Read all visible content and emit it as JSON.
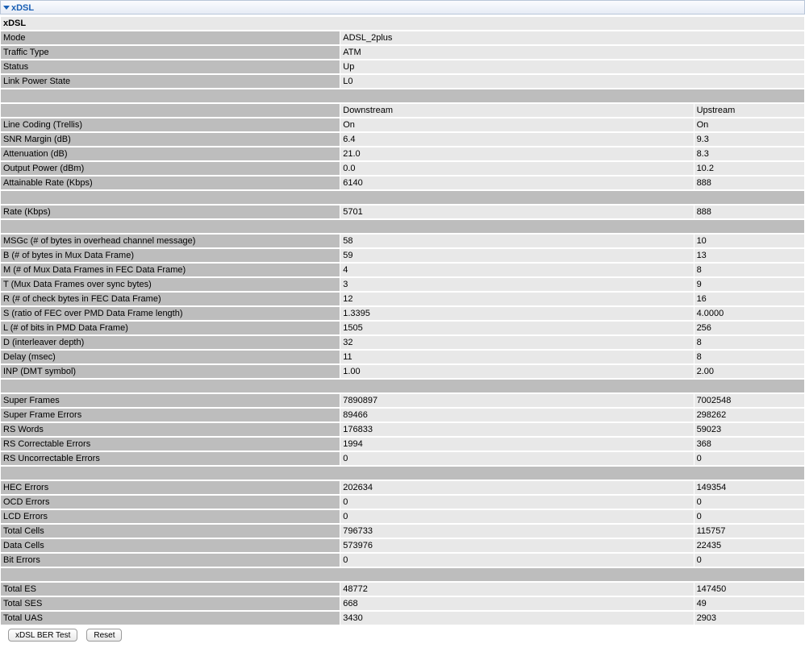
{
  "header": {
    "title": "xDSL"
  },
  "section_title": "xDSL",
  "general": [
    {
      "label": "Mode",
      "value": "ADSL_2plus"
    },
    {
      "label": "Traffic Type",
      "value": "ATM"
    },
    {
      "label": "Status",
      "value": "Up"
    },
    {
      "label": "Link Power State",
      "value": "L0"
    }
  ],
  "columns": {
    "downstream": "Downstream",
    "upstream": "Upstream"
  },
  "groups": [
    [
      {
        "label": "Line Coding (Trellis)",
        "down": "On",
        "up": "On"
      },
      {
        "label": "SNR Margin (dB)",
        "down": "6.4",
        "up": "9.3"
      },
      {
        "label": "Attenuation (dB)",
        "down": "21.0",
        "up": "8.3"
      },
      {
        "label": "Output Power (dBm)",
        "down": "0.0",
        "up": "10.2"
      },
      {
        "label": "Attainable Rate (Kbps)",
        "down": "6140",
        "up": "888"
      }
    ],
    [
      {
        "label": "Rate (Kbps)",
        "down": "5701",
        "up": "888"
      }
    ],
    [
      {
        "label": "MSGc (# of bytes in overhead channel message)",
        "down": "58",
        "up": "10"
      },
      {
        "label": "B (# of bytes in Mux Data Frame)",
        "down": "59",
        "up": "13"
      },
      {
        "label": "M (# of Mux Data Frames in FEC Data Frame)",
        "down": "4",
        "up": "8"
      },
      {
        "label": "T (Mux Data Frames over sync bytes)",
        "down": "3",
        "up": "9"
      },
      {
        "label": "R (# of check bytes in FEC Data Frame)",
        "down": "12",
        "up": "16"
      },
      {
        "label": "S (ratio of FEC over PMD Data Frame length)",
        "down": "1.3395",
        "up": "4.0000"
      },
      {
        "label": "L (# of bits in PMD Data Frame)",
        "down": "1505",
        "up": "256"
      },
      {
        "label": "D (interleaver depth)",
        "down": "32",
        "up": "8"
      },
      {
        "label": "Delay (msec)",
        "down": "11",
        "up": "8"
      },
      {
        "label": "INP (DMT symbol)",
        "down": "1.00",
        "up": "2.00"
      }
    ],
    [
      {
        "label": "Super Frames",
        "down": "7890897",
        "up": "7002548"
      },
      {
        "label": "Super Frame Errors",
        "down": "89466",
        "up": "298262"
      },
      {
        "label": "RS Words",
        "down": "176833",
        "up": "59023"
      },
      {
        "label": "RS Correctable Errors",
        "down": "1994",
        "up": "368"
      },
      {
        "label": "RS Uncorrectable Errors",
        "down": "0",
        "up": "0"
      }
    ],
    [
      {
        "label": "HEC Errors",
        "down": "202634",
        "up": "149354"
      },
      {
        "label": "OCD Errors",
        "down": "0",
        "up": "0"
      },
      {
        "label": "LCD Errors",
        "down": "0",
        "up": "0"
      },
      {
        "label": "Total Cells",
        "down": "796733",
        "up": "115757"
      },
      {
        "label": "Data Cells",
        "down": "573976",
        "up": "22435"
      },
      {
        "label": "Bit Errors",
        "down": "0",
        "up": "0"
      }
    ],
    [
      {
        "label": "Total ES",
        "down": "48772",
        "up": "147450"
      },
      {
        "label": "Total SES",
        "down": "668",
        "up": "49"
      },
      {
        "label": "Total UAS",
        "down": "3430",
        "up": "2903"
      }
    ]
  ],
  "buttons": {
    "ber_test": "xDSL BER Test",
    "reset": "Reset"
  },
  "colors": {
    "accent": "#1a5fb4",
    "label_bg": "#bdbdbd",
    "value_bg": "#e8e8e8"
  }
}
